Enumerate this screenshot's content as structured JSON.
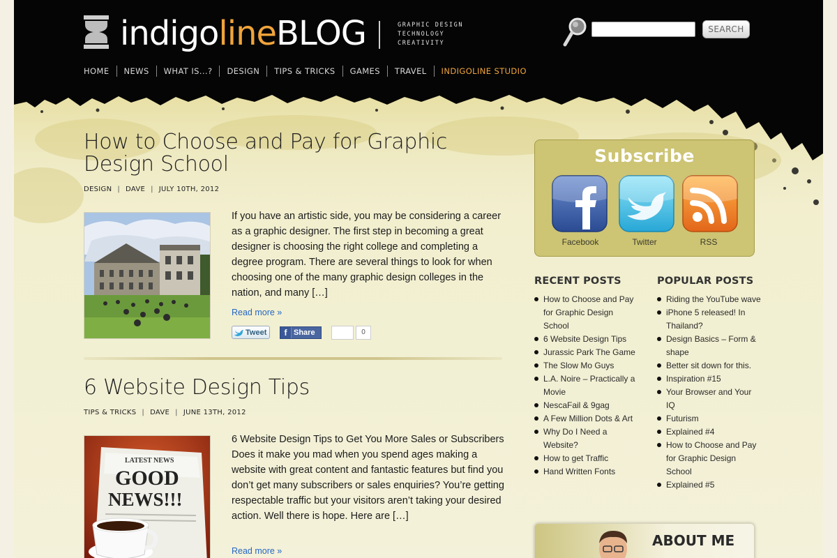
{
  "header": {
    "logo": {
      "part1": "indigo",
      "part2": "line",
      "part3": "BLOG"
    },
    "taglines": [
      "GRAPHIC DESIGN",
      "TECHNOLOGY",
      "CREATIVITY"
    ],
    "search": {
      "value": "",
      "placeholder": "",
      "button_label": "SEARCH"
    },
    "nav": [
      "HOME",
      "NEWS",
      "WHAT IS...?",
      "DESIGN",
      "TIPS & TRICKS",
      "GAMES",
      "TRAVEL",
      "INDIGOLINE STUDIO"
    ],
    "nav_active": "INDIGOLINE STUDIO"
  },
  "posts": [
    {
      "title": "How to Choose and Pay for Graphic Design School",
      "category": "DESIGN",
      "author": "DAVE",
      "date": "JULY 10TH, 2012",
      "excerpt": "If you have an artistic side, you may be considering a career as a graphic designer. The first step in becoming a great designer is choosing the right college and completing a degree program. There are several things to look for when choosing one of the many graphic design colleges in the nation, and many […]",
      "read_more": "Read more »",
      "tweet_label": "Tweet",
      "share_label": "Share",
      "like_count": "0"
    },
    {
      "title": "6 Website Design Tips",
      "category": "TIPS & TRICKS",
      "author": "DAVE",
      "date": "JUNE 13TH, 2012",
      "excerpt": "6 Website Design Tips to Get You More Sales or Subscribers Does it make you mad when you spend ages making a website with great content and fantastic features but find you don’t get many subscribers or sales enquiries? You’re getting respectable traffic but your visitors aren’t taking your desired action. Well there is hope. Here are […]",
      "read_more": "Read more »",
      "thumb_text": {
        "line1": "LATEST NEWS",
        "line2": "GOOD",
        "line3": "NEWS!!!"
      }
    }
  ],
  "sidebar": {
    "subscribe": {
      "title": "Subscribe",
      "items": [
        {
          "label": "Facebook",
          "icon": "facebook-icon"
        },
        {
          "label": "Twitter",
          "icon": "twitter-icon"
        },
        {
          "label": "RSS",
          "icon": "rss-icon"
        }
      ]
    },
    "recent_posts": {
      "title": "RECENT POSTS",
      "items": [
        "How to Choose and Pay for Graphic Design School",
        "6 Website Design Tips",
        "Jurassic Park The Game",
        "The Slow Mo Guys",
        "L.A. Noire – Practically a Movie",
        "NescaFail & 9gag",
        "A Few Million Dots & Art",
        "Why Do I Need a Website?",
        "How to get Traffic",
        "Hand Written Fonts"
      ]
    },
    "popular_posts": {
      "title": "POPULAR POSTS",
      "items": [
        "Riding the YouTube wave",
        "iPhone 5 released! In Thailand?",
        "Design Basics – Form & shape",
        "Better sit down for this.",
        "Inspiration #15",
        "Your Browser and Your IQ",
        "Futurism",
        "Explained #4",
        "How to Choose and Pay for Graphic Design School",
        "Explained #5"
      ]
    },
    "about": {
      "title": "ABOUT ME"
    }
  },
  "colors": {
    "accent": "#f0a43b",
    "link": "#2466c4",
    "header_bg": "#050505",
    "subscribe_bg": "#cdc474"
  }
}
